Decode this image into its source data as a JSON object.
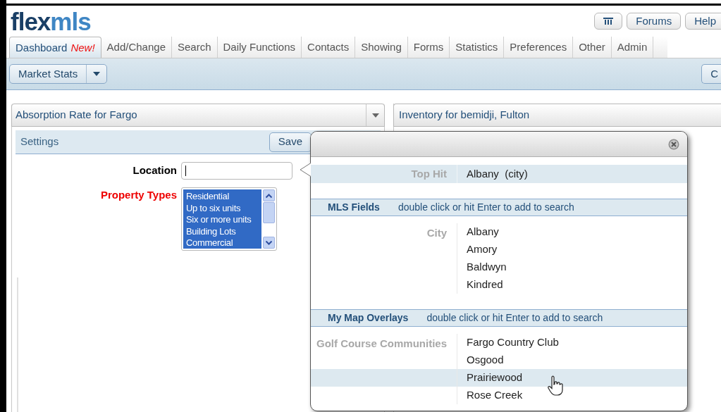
{
  "logo": {
    "first": "flex",
    "second": "mls"
  },
  "top_buttons": [
    {
      "kind": "icon"
    },
    {
      "kind": "text",
      "label": "Forums"
    },
    {
      "kind": "text",
      "label": "Help"
    }
  ],
  "tabs": [
    {
      "label": "Dashboard",
      "badge": "New!",
      "selected": true
    },
    {
      "label": "Add/Change",
      "selected": false
    },
    {
      "label": "Search",
      "selected": false
    },
    {
      "label": "Daily Functions",
      "selected": false
    },
    {
      "label": "Contacts",
      "selected": false
    },
    {
      "label": "Showing",
      "selected": false
    },
    {
      "label": "Forms",
      "selected": false
    },
    {
      "label": "Statistics",
      "selected": false
    },
    {
      "label": "Preferences",
      "selected": false
    },
    {
      "label": "Other",
      "selected": false
    },
    {
      "label": "Admin",
      "selected": false
    }
  ],
  "toolbar": {
    "split_button": {
      "label": "Market Stats"
    },
    "right_button": {
      "label": "C"
    }
  },
  "left_panel": {
    "title": "Absorption Rate for Fargo",
    "settings": {
      "title": "Settings",
      "save": "Save"
    },
    "location": {
      "label": "Location"
    },
    "property_types": {
      "label": "Property Types",
      "options": [
        {
          "label": "Residential",
          "selected": true
        },
        {
          "label": "Up to six units",
          "selected": true
        },
        {
          "label": "Six or more units",
          "selected": true
        },
        {
          "label": "Building Lots",
          "selected": true
        },
        {
          "label": "Commercial",
          "selected": true
        }
      ]
    }
  },
  "right_panel": {
    "title": "Inventory for bemidji, Fulton"
  },
  "popup": {
    "top_hit": {
      "label": "Top Hit",
      "value": "Albany  (city)"
    },
    "sections": [
      {
        "title": "MLS Fields",
        "hint": "double click or hit Enter to add to search",
        "groups": [
          {
            "label": "City",
            "items": [
              {
                "label": "Albany",
                "selected": false
              },
              {
                "label": "Amory",
                "selected": false
              },
              {
                "label": "Baldwyn",
                "selected": false
              },
              {
                "label": "Kindred",
                "selected": false
              }
            ]
          }
        ]
      },
      {
        "title": "My Map Overlays",
        "hint": "double click or hit Enter to add to search",
        "groups": [
          {
            "label": "Golf Course Communities",
            "items": [
              {
                "label": "Fargo Country Club",
                "selected": false
              },
              {
                "label": "Osgood",
                "selected": false
              },
              {
                "label": "Prairiewood",
                "selected": true
              },
              {
                "label": "Rose Creek",
                "selected": false
              }
            ]
          }
        ]
      }
    ]
  }
}
